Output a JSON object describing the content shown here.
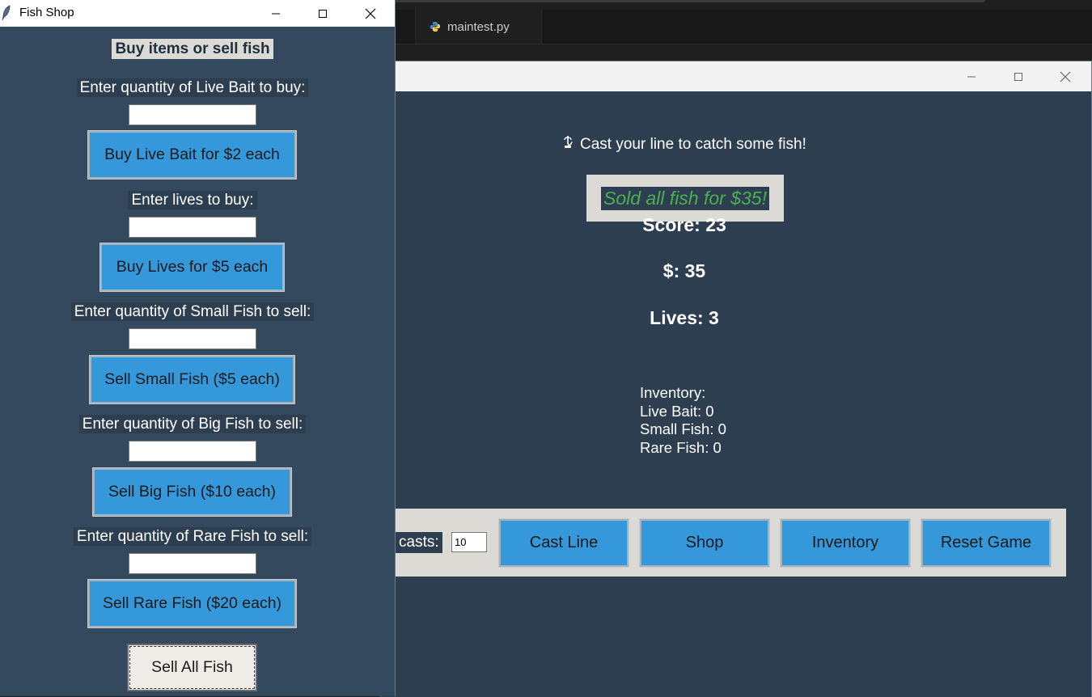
{
  "editor": {
    "tab_label": "maintest.py",
    "tab_icon": "python-icon"
  },
  "game": {
    "cast_message": "Cast your line to catch some fish!",
    "cast_icon": "fishing-hook-icon",
    "status_message": "Sold all fish for $35!",
    "status_color": "#4caf50",
    "score": "Score: 23",
    "money": "$: 35",
    "lives": "Lives: 3",
    "inventory": {
      "title": "Inventory:",
      "items": [
        "Live Bait: 0",
        "Small Fish: 0",
        "Rare Fish: 0"
      ]
    },
    "controls": {
      "casts_label": "casts:",
      "casts_value": "10",
      "buttons": [
        "Cast Line",
        "Shop",
        "Inventory",
        "Reset Game"
      ]
    },
    "colors": {
      "background": "#2c3e50",
      "button": "#3498db",
      "panel": "#dcdad5"
    }
  },
  "shop": {
    "window_title": "Fish Shop",
    "heading": "Buy items or sell fish",
    "sections": [
      {
        "label": "Enter quantity of Live Bait to buy:",
        "input": "",
        "button": "Buy Live Bait for $2 each"
      },
      {
        "label": "Enter lives to buy:",
        "input": "",
        "button": "Buy Lives for $5 each"
      },
      {
        "label": "Enter quantity of Small Fish to sell:",
        "input": "",
        "button": "Sell Small Fish ($5 each)"
      },
      {
        "label": "Enter quantity of Big Fish to sell:",
        "input": "",
        "button": "Sell Big Fish ($10 each)"
      },
      {
        "label": "Enter quantity of Rare Fish to sell:",
        "input": "",
        "button": "Sell Rare Fish ($20 each)"
      }
    ],
    "sell_all_button": "Sell All Fish",
    "colors": {
      "background": "#34495e",
      "button": "#3498db"
    }
  }
}
